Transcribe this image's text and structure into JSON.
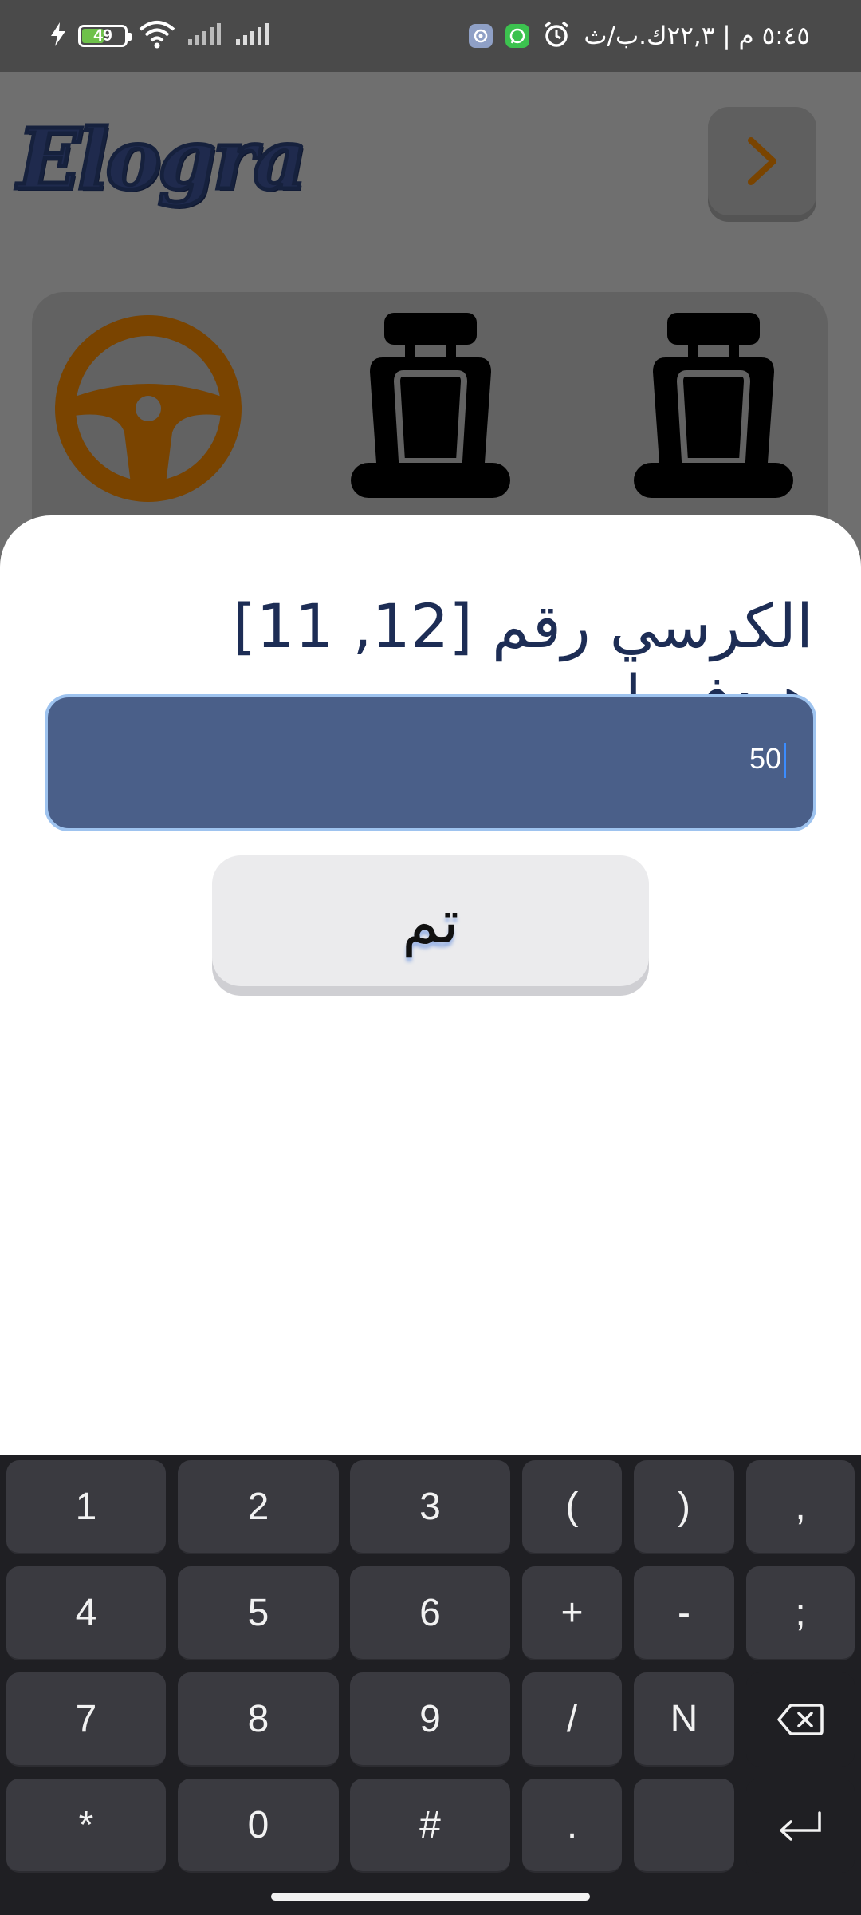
{
  "status_bar": {
    "battery": "49",
    "time": "٥:٤٥ م | ٢٢,٣ك.ب/ث"
  },
  "app": {
    "logo": "Elogra"
  },
  "sheet": {
    "question": "الكرسي رقم [12, 11] هيدفعوا",
    "amount_value": "50",
    "done_label": "تم"
  },
  "keyboard": {
    "row1": [
      "1",
      "2",
      "3",
      "(",
      ")",
      ","
    ],
    "row2": [
      "4",
      "5",
      "6",
      "+",
      "-",
      ";"
    ],
    "row3": [
      "7",
      "8",
      "9",
      "/",
      "N"
    ],
    "row4": [
      "*",
      "0",
      "#",
      ".",
      ""
    ]
  },
  "colors": {
    "accent_orange": "#7a4400",
    "field_blue": "#4a5f89",
    "title_navy": "#1d2d55"
  }
}
